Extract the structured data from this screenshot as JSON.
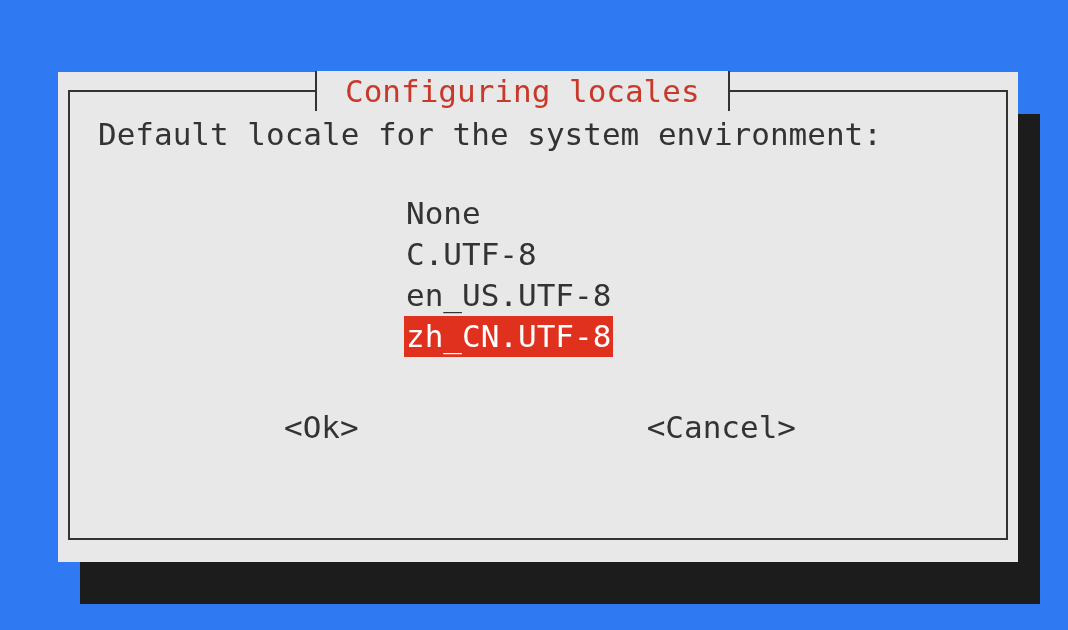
{
  "dialog": {
    "title": "Configuring locales",
    "prompt": "Default locale for the system environment:",
    "items": [
      {
        "label": "None",
        "selected": false
      },
      {
        "label": "C.UTF-8",
        "selected": false
      },
      {
        "label": "en_US.UTF-8",
        "selected": false
      },
      {
        "label": "zh_CN.UTF-8",
        "selected": true
      }
    ],
    "buttons": [
      "<Ok>",
      "<Cancel>"
    ]
  }
}
